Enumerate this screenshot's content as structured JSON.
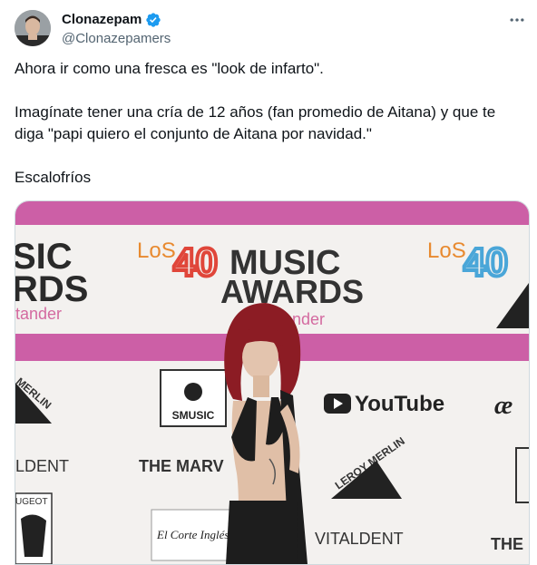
{
  "author": {
    "display_name": "Clonazepam",
    "handle": "@Clonazepamers",
    "verified": true,
    "avatar_icon": "profile-photo"
  },
  "menu": {
    "more_icon": "more-horizontal-icon"
  },
  "tweet": {
    "paragraphs": [
      "Ahora ir como una fresca es \"look de infarto\".",
      "Imagínate tener una cría de 12 años (fan promedio de Aitana) y que te diga \"papi quiero el conjunto de Aitana por navidad.\"",
      "Escalofríos"
    ]
  },
  "media": {
    "type": "photo",
    "backdrop_texts": {
      "music_left": "SIC",
      "awards_left": "RDS",
      "tander_left": "tander",
      "los40_center": "LoS",
      "music_center": "MUSIC",
      "awards_center": "AWARDS",
      "tander_center": "tander",
      "los40_right": "LoS",
      "smusic": "SMUSIC",
      "youtube": "YouTube",
      "merlin_left": "MERLIN",
      "leroy_merlin": "LEROY MERLIN",
      "vitaldent_left": "LDENT",
      "the_marvel": "THE MARV",
      "vitaldent_right": "VITALDENT",
      "the_right": "THE",
      "peugeot": "UGEOT",
      "corte_ingles": "El Corte Inglés",
      "ae": "æ"
    },
    "colors": {
      "band": "#cc5fa6",
      "backdrop": "#f3f1ef",
      "hair": "#8c1c24",
      "dark": "#1d1d1d",
      "verified_blue": "#1d9bf0"
    }
  }
}
